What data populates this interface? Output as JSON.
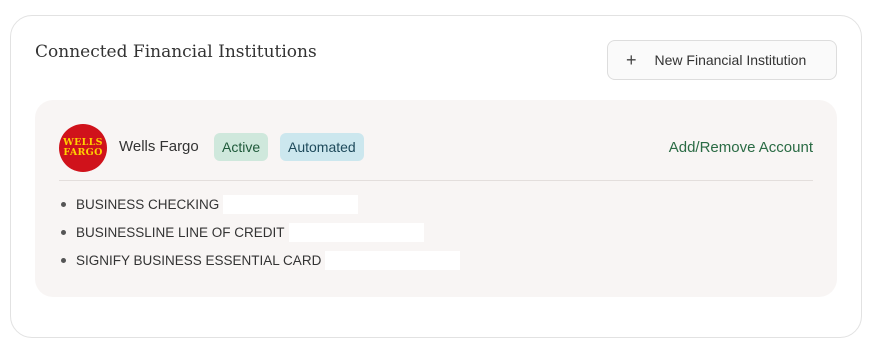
{
  "section": {
    "title": "Connected Financial Institutions",
    "new_button_icon": "plus-icon",
    "new_button_label": "New Financial Institution"
  },
  "institution": {
    "logo_text_line1": "WELLS",
    "logo_text_line2": "FARGO",
    "logo_colors": {
      "background": "#d0121b",
      "text": "#ffd200"
    },
    "name": "Wells Fargo",
    "badges": [
      "Active",
      "Automated"
    ],
    "manage_link": "Add/Remove Account",
    "accounts": [
      {
        "name": "BUSINESS CHECKING"
      },
      {
        "name": "BUSINESSLINE LINE OF CREDIT"
      },
      {
        "name": "SIGNIFY BUSINESS ESSENTIAL CARD"
      }
    ]
  }
}
